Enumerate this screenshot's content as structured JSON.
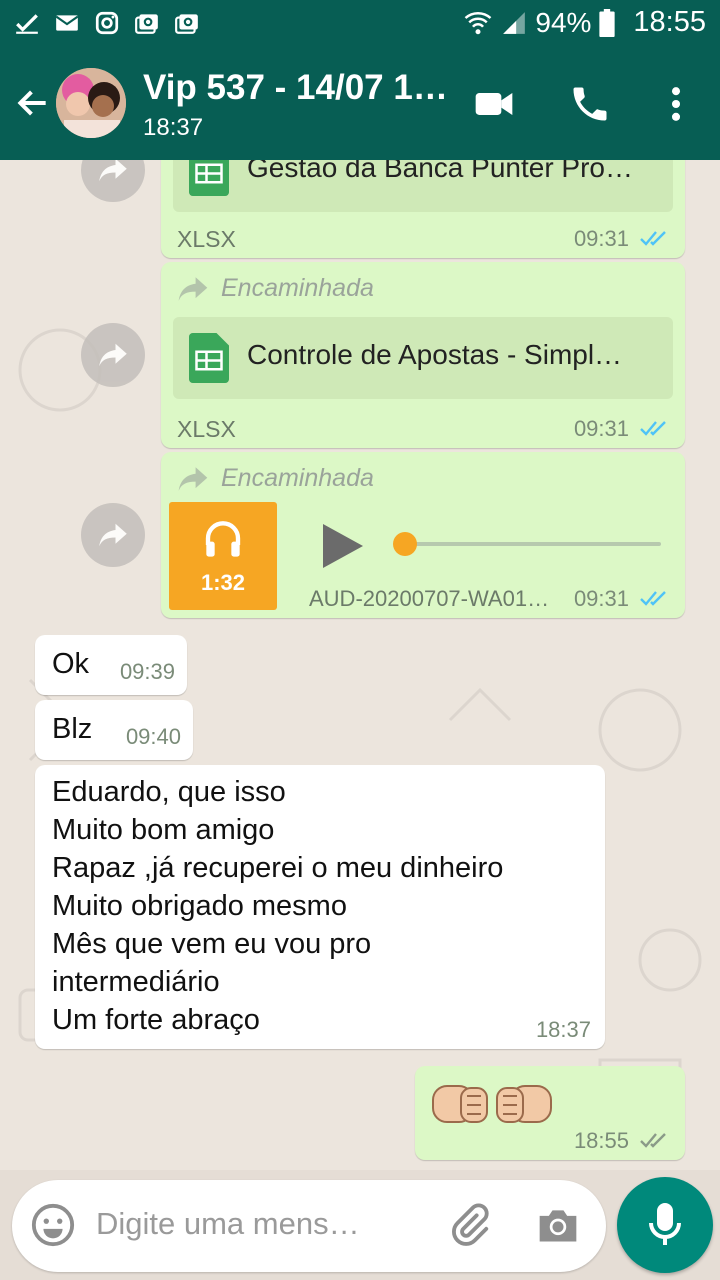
{
  "status_bar": {
    "battery": "94%",
    "time": "18:55",
    "notification_icons": [
      "check-icon",
      "mail-icon",
      "instagram-icon",
      "photo-icon",
      "photo-icon"
    ]
  },
  "header": {
    "title": "Vip 537 - 14/07 1…",
    "subtitle": "18:37"
  },
  "messages": [
    {
      "type": "document",
      "direction": "out",
      "forwarded": false,
      "name": "Gestao da Banca Punter Pro…",
      "file_type": "XLSX",
      "time": "09:31",
      "status": "read"
    },
    {
      "type": "document",
      "direction": "out",
      "forwarded": true,
      "forward_label": "Encaminhada",
      "name": "Controle de Apostas - Simpl…",
      "file_type": "XLSX",
      "time": "09:31",
      "status": "read"
    },
    {
      "type": "audio",
      "direction": "out",
      "forwarded": true,
      "forward_label": "Encaminhada",
      "duration": "1:32",
      "name": "AUD-20200707-WA01…",
      "time": "09:31",
      "status": "read"
    },
    {
      "type": "text",
      "direction": "in",
      "text": "Ok",
      "time": "09:39"
    },
    {
      "type": "text",
      "direction": "in",
      "text": "Blz",
      "time": "09:40"
    },
    {
      "type": "text",
      "direction": "in",
      "lines": [
        "Eduardo, que isso",
        "Muito bom amigo",
        "Rapaz ,já recuperei o meu dinheiro",
        "Muito obrigado mesmo",
        "Mês que vem eu vou pro",
        "intermediário",
        "Um forte abraço"
      ],
      "time": "18:37"
    },
    {
      "type": "emoji",
      "direction": "out",
      "emoji": "🤜🤛",
      "time": "18:55",
      "status": "delivered"
    }
  ],
  "input": {
    "placeholder": "Digite uma mens…"
  },
  "colors": {
    "header": "#075e54",
    "outgoing_bubble": "#dcf8c6",
    "incoming_bubble": "#ffffff",
    "read_ticks": "#4fc3f7",
    "mic_button": "#00897b",
    "audio_accent": "#f6a623"
  }
}
